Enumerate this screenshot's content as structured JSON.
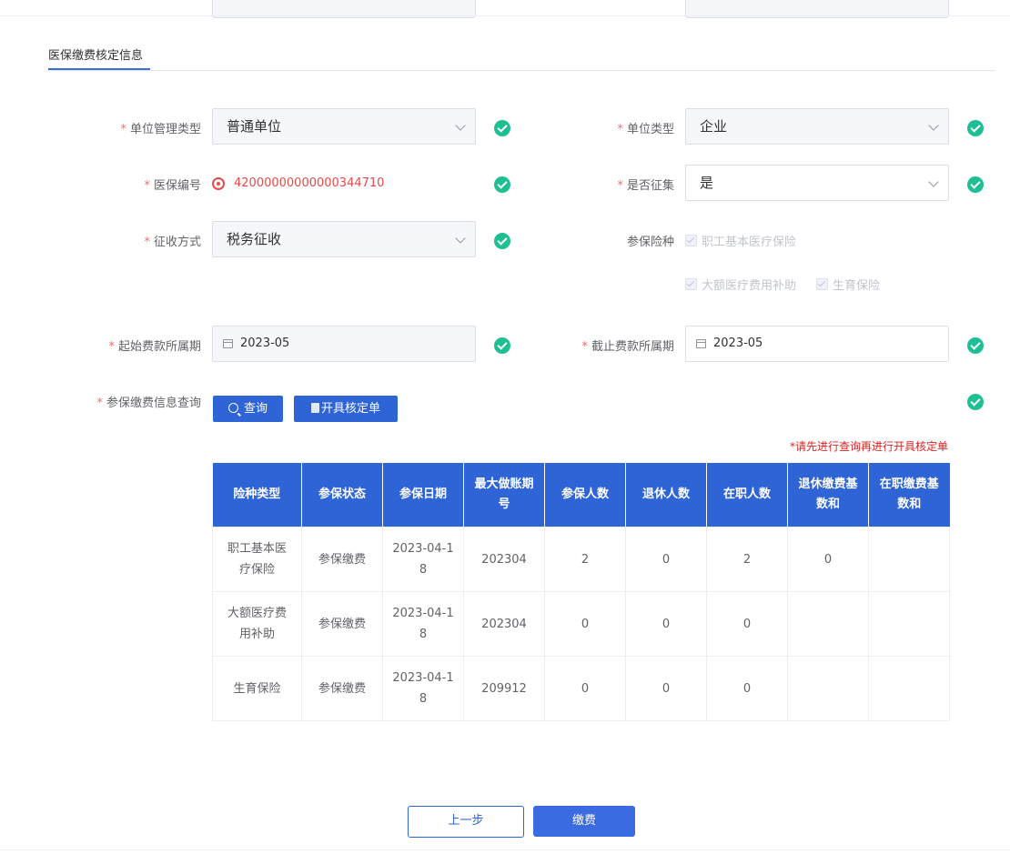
{
  "section": {
    "tab": "医保缴费核定信息"
  },
  "form": {
    "unit_mgmt_type": {
      "label": "单位管理类型",
      "value": "普通单位"
    },
    "unit_type": {
      "label": "单位类型",
      "value": "企业"
    },
    "insurance_no": {
      "label": "医保编号",
      "value": "42000000000000344710"
    },
    "is_collect": {
      "label": "是否征集",
      "value": "是"
    },
    "collect_method": {
      "label": "征收方式",
      "value": "税务征收"
    },
    "insurance_types": {
      "label": "参保险种",
      "options": [
        "职工基本医疗保险",
        "大额医疗费用补助",
        "生育保险"
      ]
    },
    "start_period": {
      "label": "起始费款所属期",
      "value": "2023-05"
    },
    "end_period": {
      "label": "截止费款所属期",
      "value": "2023-05"
    },
    "query": {
      "label": "参保缴费信息查询",
      "query_button": "查询",
      "issue_button": "开具核定单"
    },
    "required_mark": "*"
  },
  "hint": "*请先进行查询再进行开具核定单",
  "table": {
    "headers": [
      "险种类型",
      "参保状态",
      "参保日期",
      "最大做账期号",
      "参保人数",
      "退休人数",
      "在职人数",
      "退休缴费基数和",
      "在职缴费基数和"
    ],
    "rows": [
      [
        "职工基本医疗保险",
        "参保缴费",
        "2023-04-18",
        "202304",
        "2",
        "0",
        "2",
        "0",
        ""
      ],
      [
        "大额医疗费用补助",
        "参保缴费",
        "2023-04-18",
        "202304",
        "0",
        "0",
        "0",
        "",
        ""
      ],
      [
        "生育保险",
        "参保缴费",
        "2023-04-18",
        "209912",
        "0",
        "0",
        "0",
        "",
        ""
      ]
    ]
  },
  "footer": {
    "back_button": "上一步",
    "pay_button": "缴费"
  },
  "colors": {
    "primary": "#2f64d6",
    "success": "#1fbf94",
    "error": "#e84a4a"
  }
}
